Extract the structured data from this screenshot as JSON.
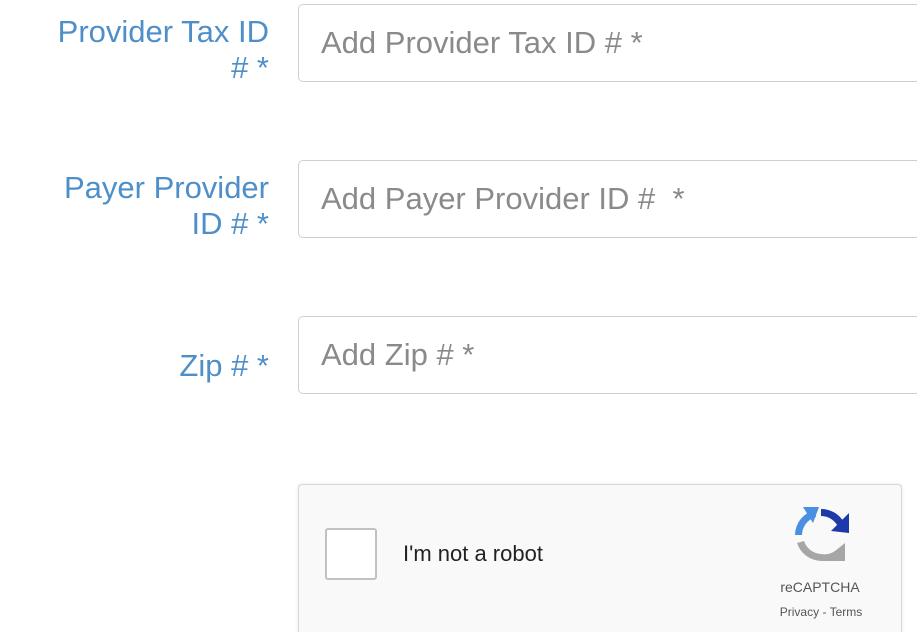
{
  "form": {
    "tax_id": {
      "label_line1": "Provider Tax ID",
      "label_line2": "# *",
      "placeholder": "Add Provider Tax ID # *",
      "value": ""
    },
    "payer_id": {
      "label_line1": "Payer Provider",
      "label_line2": "ID # *",
      "placeholder": "Add Payer Provider ID #  *",
      "value": ""
    },
    "zip": {
      "label": "Zip # *",
      "placeholder": "Add Zip # *",
      "value": ""
    }
  },
  "recaptcha": {
    "checkbox_label": "I'm not a robot",
    "brand": "reCAPTCHA",
    "privacy_link": "Privacy",
    "separator": " - ",
    "terms_link": "Terms",
    "checked": false,
    "logo_icon": "recaptcha-logo-icon"
  },
  "colors": {
    "label": "#4f8fc9",
    "input_border": "#cfcfcf",
    "placeholder": "#8a8a8a",
    "recaptcha_blue": "#1c3aa9",
    "recaptcha_lightblue": "#4a90e2",
    "recaptcha_gray": "#a6a6a6"
  }
}
